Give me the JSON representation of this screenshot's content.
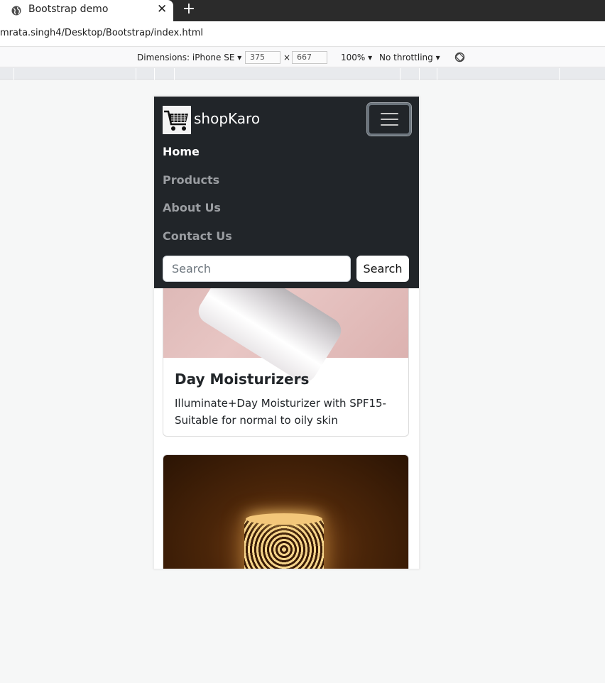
{
  "browser": {
    "tab_title": "Bootstrap demo",
    "close_glyph": "✕",
    "new_tab_glyph": "+",
    "url": "mrata.singh4/Desktop/Bootstrap/index.html"
  },
  "devtools": {
    "dimensions_label": "Dimensions: iPhone SE ▾",
    "width": "375",
    "times": "×",
    "height": "667",
    "zoom": "100% ▾",
    "throttling": "No throttling ▾"
  },
  "navbar": {
    "brand": "shopKaro",
    "links": [
      {
        "label": "Home"
      },
      {
        "label": "Products"
      },
      {
        "label": "About Us"
      },
      {
        "label": "Contact Us"
      }
    ],
    "search_placeholder": "Search",
    "search_button": "Search"
  },
  "cards": [
    {
      "title": "Day Moisturizers",
      "text": "Illuminate+Day Moisturizer with SPF15-Suitable for normal to oily skin"
    }
  ]
}
